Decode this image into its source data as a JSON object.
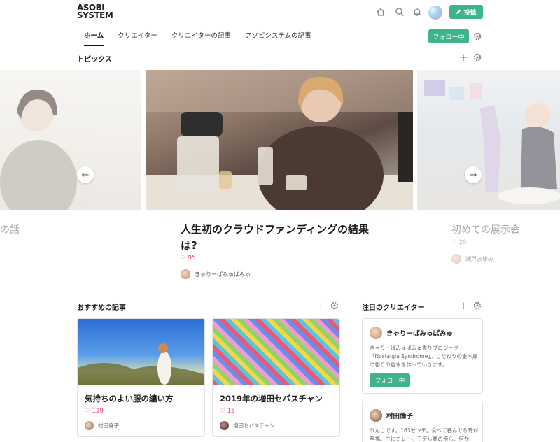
{
  "brand": {
    "logo_line1": "ASOBI",
    "logo_line2": "SYSTEM"
  },
  "header": {
    "post_label": "投稿",
    "icons": [
      "home-icon",
      "search-icon",
      "bell-icon"
    ]
  },
  "nav": {
    "items": [
      "ホーム",
      "クリエイター",
      "クリエイターの記事",
      "アソビシステムの記事"
    ],
    "follow_label": "フォロー中"
  },
  "topics": {
    "title": "トピックス",
    "left_title": "の話",
    "main": {
      "title": "人生初のクラウドファンディングの結果は?",
      "likes": "95",
      "author": "きゃりーぱみゅぱみゅ"
    },
    "right": {
      "title": "初めての展示会",
      "likes": "20",
      "author": "瀬戸あゆみ"
    }
  },
  "recommended": {
    "title": "おすすめの記事",
    "cards": [
      {
        "title": "気持ちのよい服の纏い方",
        "likes": "129",
        "author": "村田倫子"
      },
      {
        "title": "2019年の増田セバスチャン",
        "likes": "15",
        "author": "増田セバスチャン"
      }
    ]
  },
  "creators": {
    "title": "注目のクリエイター",
    "items": [
      {
        "name": "きゃりーぱみゅぱみゅ",
        "bio": "きゃりーぱみゅぱみゅ香りプロジェクト「Nostalgia Syndrome」。こだわりの金木犀の香りの香水を作っていきます。",
        "follow_label": "フォロー中"
      },
      {
        "name": "村田倫子",
        "bio": "りんこです。163センチ。食べて呑んでる時が至福。主にカレー。モデル業の傍ら、何か"
      }
    ]
  },
  "colors": {
    "accent": "#3fb48a",
    "like": "#e0406b"
  }
}
